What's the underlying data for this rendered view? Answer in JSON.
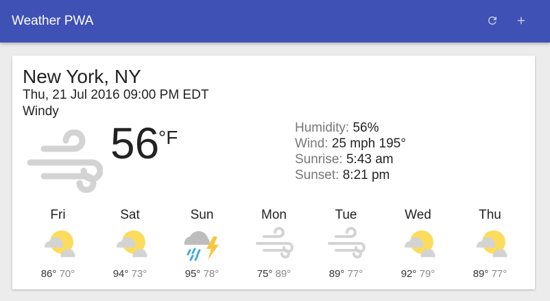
{
  "app": {
    "title": "Weather PWA"
  },
  "header": {
    "refresh_icon": "refresh-icon",
    "add_icon": "plus-icon"
  },
  "current": {
    "location": "New York, NY",
    "date": "Thu, 21 Jul 2016 09:00 PM EDT",
    "description": "Windy",
    "icon": "wind-icon",
    "temperature": "56",
    "unit": "°F",
    "details": [
      {
        "label": "Humidity:",
        "value": "56%"
      },
      {
        "label": "Wind:",
        "value": "25 mph 195°"
      },
      {
        "label": "Sunrise:",
        "value": "5:43 am"
      },
      {
        "label": "Sunset:",
        "value": "8:21 pm"
      }
    ]
  },
  "forecast": [
    {
      "day": "Fri",
      "icon": "partly-cloudy-icon",
      "high": "86°",
      "low": "70°"
    },
    {
      "day": "Sat",
      "icon": "partly-cloudy-icon",
      "high": "94°",
      "low": "73°"
    },
    {
      "day": "Sun",
      "icon": "thunderstorm-icon",
      "high": "95°",
      "low": "78°"
    },
    {
      "day": "Mon",
      "icon": "wind-icon",
      "high": "75°",
      "low": "89°"
    },
    {
      "day": "Tue",
      "icon": "wind-icon",
      "high": "89°",
      "low": "77°"
    },
    {
      "day": "Wed",
      "icon": "partly-cloudy-icon",
      "high": "92°",
      "low": "79°"
    },
    {
      "day": "Thu",
      "icon": "partly-cloudy-icon",
      "high": "89°",
      "low": "77°"
    }
  ],
  "colors": {
    "header": "#3f51b5",
    "sun": "#fcdc5d",
    "cloud": "#d3d3d3",
    "wind": "#cfcfcf",
    "rain": "#3fa9e0",
    "lightning": "#f9c53d"
  }
}
